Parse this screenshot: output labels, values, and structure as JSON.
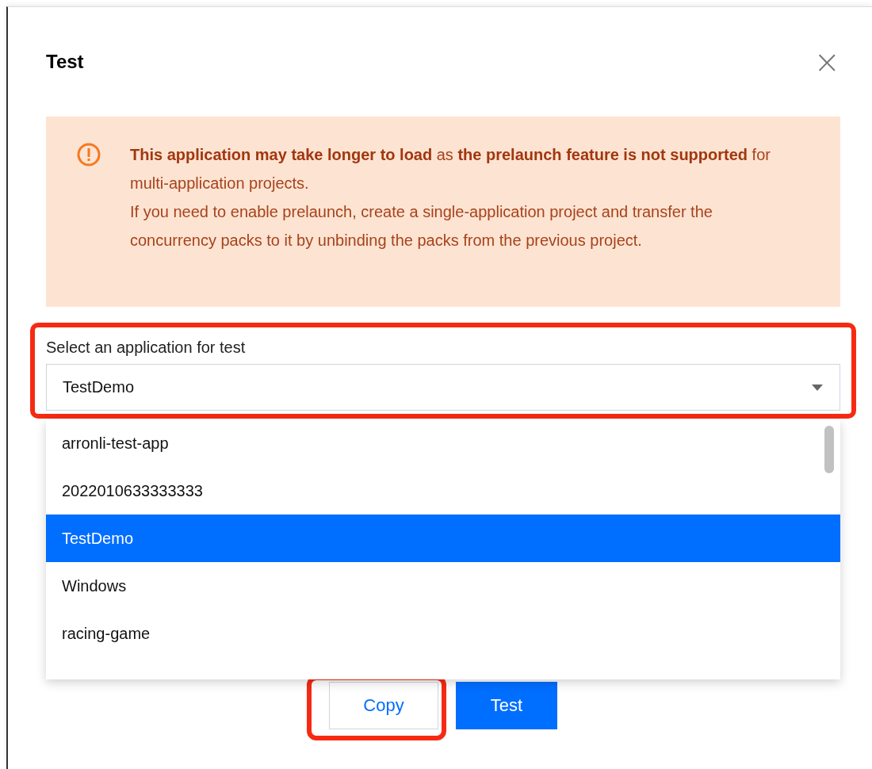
{
  "dialog": {
    "title": "Test",
    "close": "×"
  },
  "alert": {
    "paragraphs": [
      "**This application may take longer to load** as **the prelaunch feature is not supported** for multi-application projects.",
      "If you need to enable prelaunch, create a single-application project and transfer the concurrency packs to it by unbinding the packs from the previous project."
    ]
  },
  "select": {
    "label": "Select an application for test",
    "value": "TestDemo",
    "expanded": true,
    "highlighted": true
  },
  "options": [
    {
      "label": "arronli-test-app",
      "selected": false
    },
    {
      "label": "2022010633333333",
      "selected": false
    },
    {
      "label": "TestDemo",
      "selected": true
    },
    {
      "label": "Windows",
      "selected": false
    },
    {
      "label": "racing-game",
      "selected": false
    }
  ],
  "buttons": [
    {
      "label": "Copy",
      "kind": "secondary",
      "highlighted": true
    },
    {
      "label": "Test",
      "kind": "primary",
      "highlighted": false
    }
  ]
}
